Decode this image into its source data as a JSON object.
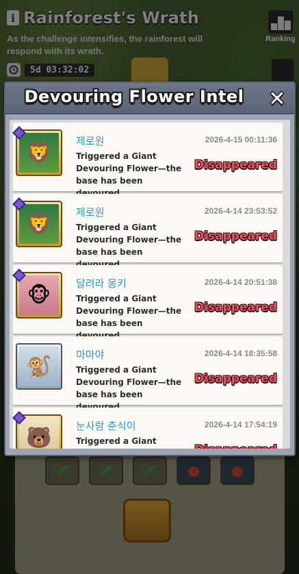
{
  "challenge": {
    "title": "Rainforest's Wrath",
    "description": "As the challenge intensifies, the rainforest will respond with its wrath.",
    "timer": "5d 03:32:02",
    "ranking_label": "Ranking"
  },
  "modal": {
    "title": "Devouring Flower Intel",
    "close_icon": "close-icon"
  },
  "entries": [
    {
      "player": "제로원",
      "timestamp": "2026-4-15 00:11:36",
      "event": "Triggered a Giant Devouring Flower—the base has been devoured.",
      "status": "Disappeared",
      "avatar": "jungle-hero",
      "frame": "gold"
    },
    {
      "player": "제로원",
      "timestamp": "2026-4-14 23:53:52",
      "event": "Triggered a Giant Devouring Flower—the base has been devoured.",
      "status": "Disappeared",
      "avatar": "jungle-hero",
      "frame": "gold"
    },
    {
      "player": "달려라 몽키",
      "timestamp": "2026-4-14 20:51:38",
      "event": "Triggered a Giant Devouring Flower—the base has been devoured.",
      "status": "Disappeared",
      "avatar": "pink-monkey",
      "frame": "gold"
    },
    {
      "player": "마마야",
      "timestamp": "2026-4-14 18:35:58",
      "event": "Triggered a Giant Devouring Flower—the base has been devoured.",
      "status": "Disappeared",
      "avatar": "blue-monkey",
      "frame": "silver"
    },
    {
      "player": "눈사람 춘식이",
      "timestamp": "2026-4-14 17:54:19",
      "event": "Triggered a Giant Devouring Flower—the base has been devoured.",
      "status": "Disappeared",
      "avatar": "cream-character",
      "frame": "gold"
    }
  ],
  "colors": {
    "player_name": "#2b98c8",
    "status": "#ef4e5e",
    "modal_header": "#6c7688"
  }
}
